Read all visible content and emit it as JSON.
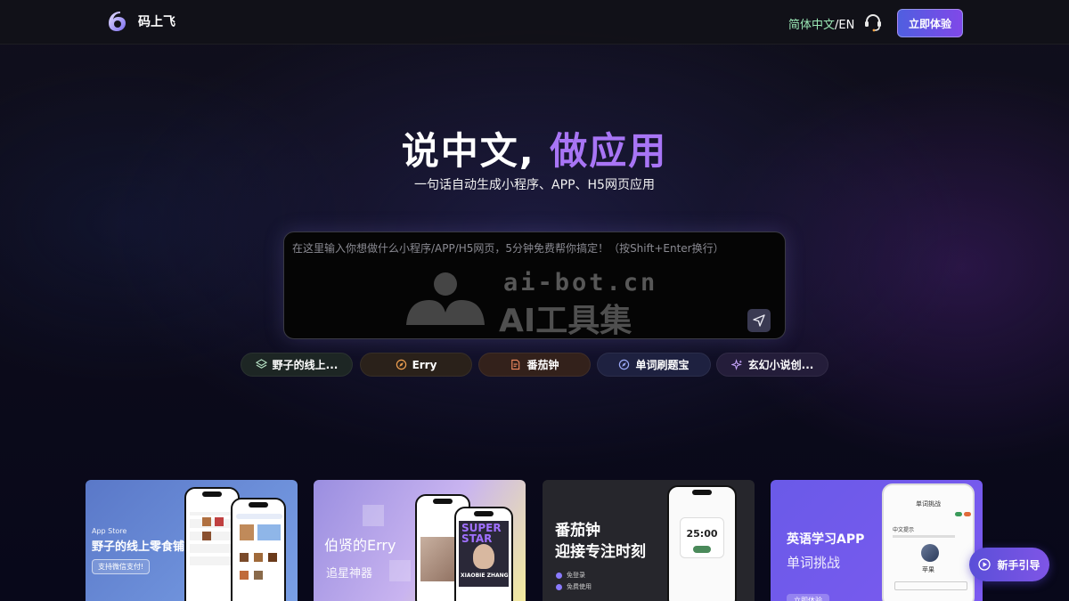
{
  "header": {
    "logo_text": "码上飞",
    "lang_zh": "简体中文",
    "lang_sep": "/",
    "lang_en": "EN",
    "cta": "立即体验"
  },
  "hero": {
    "title_main": "说中文,",
    "title_accent": "做应用",
    "subtitle": "一句话自动生成小程序、APP、H5网页应用"
  },
  "prompt": {
    "placeholder": "在这里输入你想做什么小程序/APP/H5网页，5分钟免费帮你搞定！（按Shift+Enter换行）"
  },
  "watermark": {
    "domain": "ai-bot.cn",
    "title": "AI工具集"
  },
  "chips": [
    {
      "label": "野子的线上...",
      "icon": "layers-icon"
    },
    {
      "label": "Erry",
      "icon": "compass-icon"
    },
    {
      "label": "番茄钟",
      "icon": "document-icon"
    },
    {
      "label": "单词刷题宝",
      "icon": "compass-icon"
    },
    {
      "label": "玄幻小说创...",
      "icon": "sparkle-icon"
    }
  ],
  "cards": [
    {
      "tag": "App Store",
      "title": "野子的线上零食铺",
      "badge": "支持微信支付!"
    },
    {
      "title": "伯贤的Erry",
      "subtitle": "追星神器",
      "poster_line1": "SUPER",
      "poster_line2": "STAR",
      "poster_name": "XIAOBIE ZHANG"
    },
    {
      "title_line1": "番茄钟",
      "title_line2": "迎接专注时刻",
      "feature1": "免登录",
      "feature2": "免费使用",
      "timer": "25:00"
    },
    {
      "title": "英语学习APP",
      "subtitle": "单词挑战",
      "screen_header": "单词挑战",
      "screen_label": "中文提示",
      "screen_word": "苹果",
      "button": "立即体验"
    }
  ],
  "guide": {
    "label": "新手引导"
  }
}
